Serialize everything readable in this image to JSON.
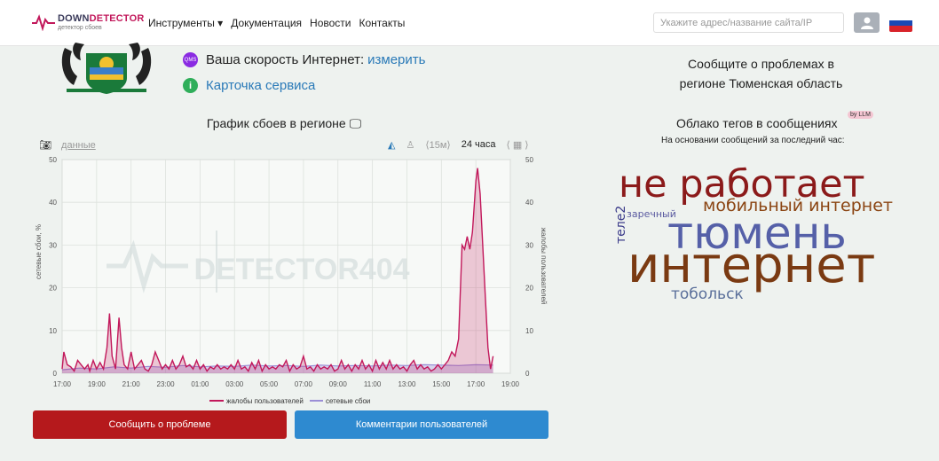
{
  "header": {
    "logo_title_part1": "DOWN",
    "logo_title_part2": "DETECTOR",
    "logo_subtitle": "детектор сбоев",
    "nav": [
      {
        "label": "Инструменты ▾"
      },
      {
        "label": "Документация"
      },
      {
        "label": "Новости"
      },
      {
        "label": "Контакты"
      }
    ],
    "search_placeholder": "Укажите адрес/название сайта/IP",
    "user_icon": "user-icon",
    "flag_colors": [
      "#ffffff",
      "#1a49b5",
      "#d8232a"
    ]
  },
  "info": {
    "speed_badge": "QMS",
    "speed_label": "Ваша скорость Интернет:",
    "speed_link": "измерить",
    "card_badge": "i",
    "card_link": "Карточка сервиса"
  },
  "chart_section": {
    "title": "График сбоев в регионе 🖵",
    "data_link": "данные",
    "range_15m": "⟨15м⟩",
    "range_24h": "24 часа",
    "range_next": "⟨",
    "cal_next": "⟩"
  },
  "chart_data": {
    "type": "area",
    "watermark": "DETECTOR404",
    "ylabel_left": "сетевые сбои, %",
    "ylabel_right": "жалобы пользователей",
    "ylim": [
      0,
      50
    ],
    "yticks": [
      0,
      10,
      20,
      30,
      40,
      50
    ],
    "xticks": [
      "17:00",
      "19:00",
      "21:00",
      "23:00",
      "01:00",
      "03:00",
      "05:00",
      "07:00",
      "09:00",
      "11:00",
      "13:00",
      "15:00",
      "17:00",
      "19:00"
    ],
    "x_range_hours": [
      0,
      26
    ],
    "series": [
      {
        "name": "жалобы пользователей",
        "color": "#c2185b",
        "points": [
          [
            0,
            1
          ],
          [
            0.1,
            5
          ],
          [
            0.3,
            2
          ],
          [
            0.5,
            1.5
          ],
          [
            0.7,
            0.5
          ],
          [
            0.9,
            3
          ],
          [
            1.1,
            2
          ],
          [
            1.3,
            1
          ],
          [
            1.5,
            2
          ],
          [
            1.6,
            0.5
          ],
          [
            1.8,
            3
          ],
          [
            2.0,
            1
          ],
          [
            2.2,
            2.5
          ],
          [
            2.4,
            1
          ],
          [
            2.6,
            6
          ],
          [
            2.75,
            14
          ],
          [
            2.9,
            4
          ],
          [
            3.1,
            1
          ],
          [
            3.3,
            13
          ],
          [
            3.45,
            6
          ],
          [
            3.6,
            2
          ],
          [
            3.8,
            1
          ],
          [
            4.0,
            5
          ],
          [
            4.2,
            1
          ],
          [
            4.4,
            2
          ],
          [
            4.6,
            3
          ],
          [
            4.8,
            1
          ],
          [
            5.0,
            0.5
          ],
          [
            5.2,
            2
          ],
          [
            5.4,
            5
          ],
          [
            5.6,
            3
          ],
          [
            5.8,
            1
          ],
          [
            6.0,
            2
          ],
          [
            6.2,
            1
          ],
          [
            6.4,
            3
          ],
          [
            6.6,
            1
          ],
          [
            6.8,
            2
          ],
          [
            7.0,
            4
          ],
          [
            7.2,
            1.5
          ],
          [
            7.4,
            2
          ],
          [
            7.6,
            1
          ],
          [
            7.8,
            3
          ],
          [
            8.0,
            1
          ],
          [
            8.2,
            2
          ],
          [
            8.4,
            0.5
          ],
          [
            8.6,
            1.5
          ],
          [
            8.8,
            1
          ],
          [
            9.0,
            2
          ],
          [
            9.2,
            1
          ],
          [
            9.4,
            1.5
          ],
          [
            9.6,
            1
          ],
          [
            9.8,
            2
          ],
          [
            10.0,
            1
          ],
          [
            10.2,
            3
          ],
          [
            10.4,
            1
          ],
          [
            10.6,
            1.5
          ],
          [
            10.8,
            0.5
          ],
          [
            11.0,
            2.5
          ],
          [
            11.2,
            1
          ],
          [
            11.4,
            3
          ],
          [
            11.6,
            0.5
          ],
          [
            11.8,
            2
          ],
          [
            12.0,
            1
          ],
          [
            12.2,
            1.5
          ],
          [
            12.4,
            1
          ],
          [
            12.6,
            2
          ],
          [
            12.8,
            1.5
          ],
          [
            13.0,
            3
          ],
          [
            13.2,
            0.5
          ],
          [
            13.4,
            2
          ],
          [
            13.6,
            1
          ],
          [
            13.8,
            1.5
          ],
          [
            14.0,
            4
          ],
          [
            14.2,
            1
          ],
          [
            14.4,
            1.5
          ],
          [
            14.6,
            0.5
          ],
          [
            14.8,
            2
          ],
          [
            15.0,
            1
          ],
          [
            15.2,
            1.5
          ],
          [
            15.4,
            1
          ],
          [
            15.6,
            2
          ],
          [
            15.8,
            0.5
          ],
          [
            16.0,
            1
          ],
          [
            16.2,
            3
          ],
          [
            16.4,
            1
          ],
          [
            16.6,
            2
          ],
          [
            16.8,
            0.5
          ],
          [
            17.0,
            2
          ],
          [
            17.2,
            1
          ],
          [
            17.4,
            3
          ],
          [
            17.6,
            1
          ],
          [
            17.8,
            2
          ],
          [
            18.0,
            0.5
          ],
          [
            18.2,
            3
          ],
          [
            18.4,
            1
          ],
          [
            18.6,
            2.5
          ],
          [
            18.8,
            1
          ],
          [
            19.0,
            3
          ],
          [
            19.2,
            1
          ],
          [
            19.4,
            2
          ],
          [
            19.6,
            1
          ],
          [
            19.8,
            1.5
          ],
          [
            20.0,
            0.5
          ],
          [
            20.2,
            2
          ],
          [
            20.4,
            3
          ],
          [
            20.6,
            1
          ],
          [
            20.8,
            2
          ],
          [
            21.0,
            1
          ],
          [
            21.2,
            1.5
          ],
          [
            21.4,
            0.5
          ],
          [
            21.6,
            1
          ],
          [
            21.8,
            2
          ],
          [
            22.0,
            1
          ],
          [
            22.2,
            2
          ],
          [
            22.4,
            3
          ],
          [
            22.6,
            5
          ],
          [
            22.8,
            4
          ],
          [
            23.0,
            8
          ],
          [
            23.2,
            30
          ],
          [
            23.35,
            29
          ],
          [
            23.5,
            32
          ],
          [
            23.65,
            29
          ],
          [
            23.8,
            33
          ],
          [
            24.0,
            45
          ],
          [
            24.1,
            48
          ],
          [
            24.25,
            42
          ],
          [
            24.4,
            30
          ],
          [
            24.55,
            18
          ],
          [
            24.7,
            6
          ],
          [
            24.85,
            1
          ],
          [
            25.0,
            4
          ]
        ]
      },
      {
        "name": "сетевые сбои",
        "color": "#9b8ed6",
        "points": [
          [
            0,
            0.8
          ],
          [
            1,
            1.2
          ],
          [
            2,
            1.0
          ],
          [
            3,
            1.5
          ],
          [
            4,
            1.2
          ],
          [
            5,
            1.6
          ],
          [
            6,
            1.4
          ],
          [
            7,
            1.8
          ],
          [
            8,
            1.5
          ],
          [
            9,
            1.7
          ],
          [
            10,
            1.6
          ],
          [
            11,
            1.9
          ],
          [
            12,
            1.7
          ],
          [
            13,
            1.8
          ],
          [
            14,
            1.6
          ],
          [
            15,
            1.9
          ],
          [
            16,
            1.7
          ],
          [
            17,
            1.8
          ],
          [
            18,
            1.7
          ],
          [
            19,
            1.9
          ],
          [
            20,
            1.8
          ],
          [
            21,
            2.0
          ],
          [
            22,
            1.9
          ],
          [
            23,
            1.8
          ],
          [
            24,
            2.0
          ],
          [
            25,
            1.9
          ]
        ]
      }
    ]
  },
  "buttons": {
    "report": "Сообщить о проблеме",
    "comments": "Комментарии пользователей"
  },
  "right": {
    "report_title_line1": "Сообщите о проблемах в",
    "report_title_line2": "регионе Тюменская область",
    "cloud_title": "Облако тегов в сообщениях",
    "llm_badge": "by LLM",
    "cloud_subtitle": "На основании сообщений за последний час:",
    "tags": [
      {
        "text": "не работает",
        "color": "#8b1a1a"
      },
      {
        "text": "мобильный интернет",
        "color": "#8b4513"
      },
      {
        "text": "теле2",
        "color": "#3b3b8a"
      },
      {
        "text": "заречный",
        "color": "#5a5aa0"
      },
      {
        "text": "тюмень",
        "color": "#5560a8"
      },
      {
        "text": "интернет",
        "color": "#7a3a12"
      },
      {
        "text": "тобольск",
        "color": "#5a6f9a"
      }
    ]
  }
}
